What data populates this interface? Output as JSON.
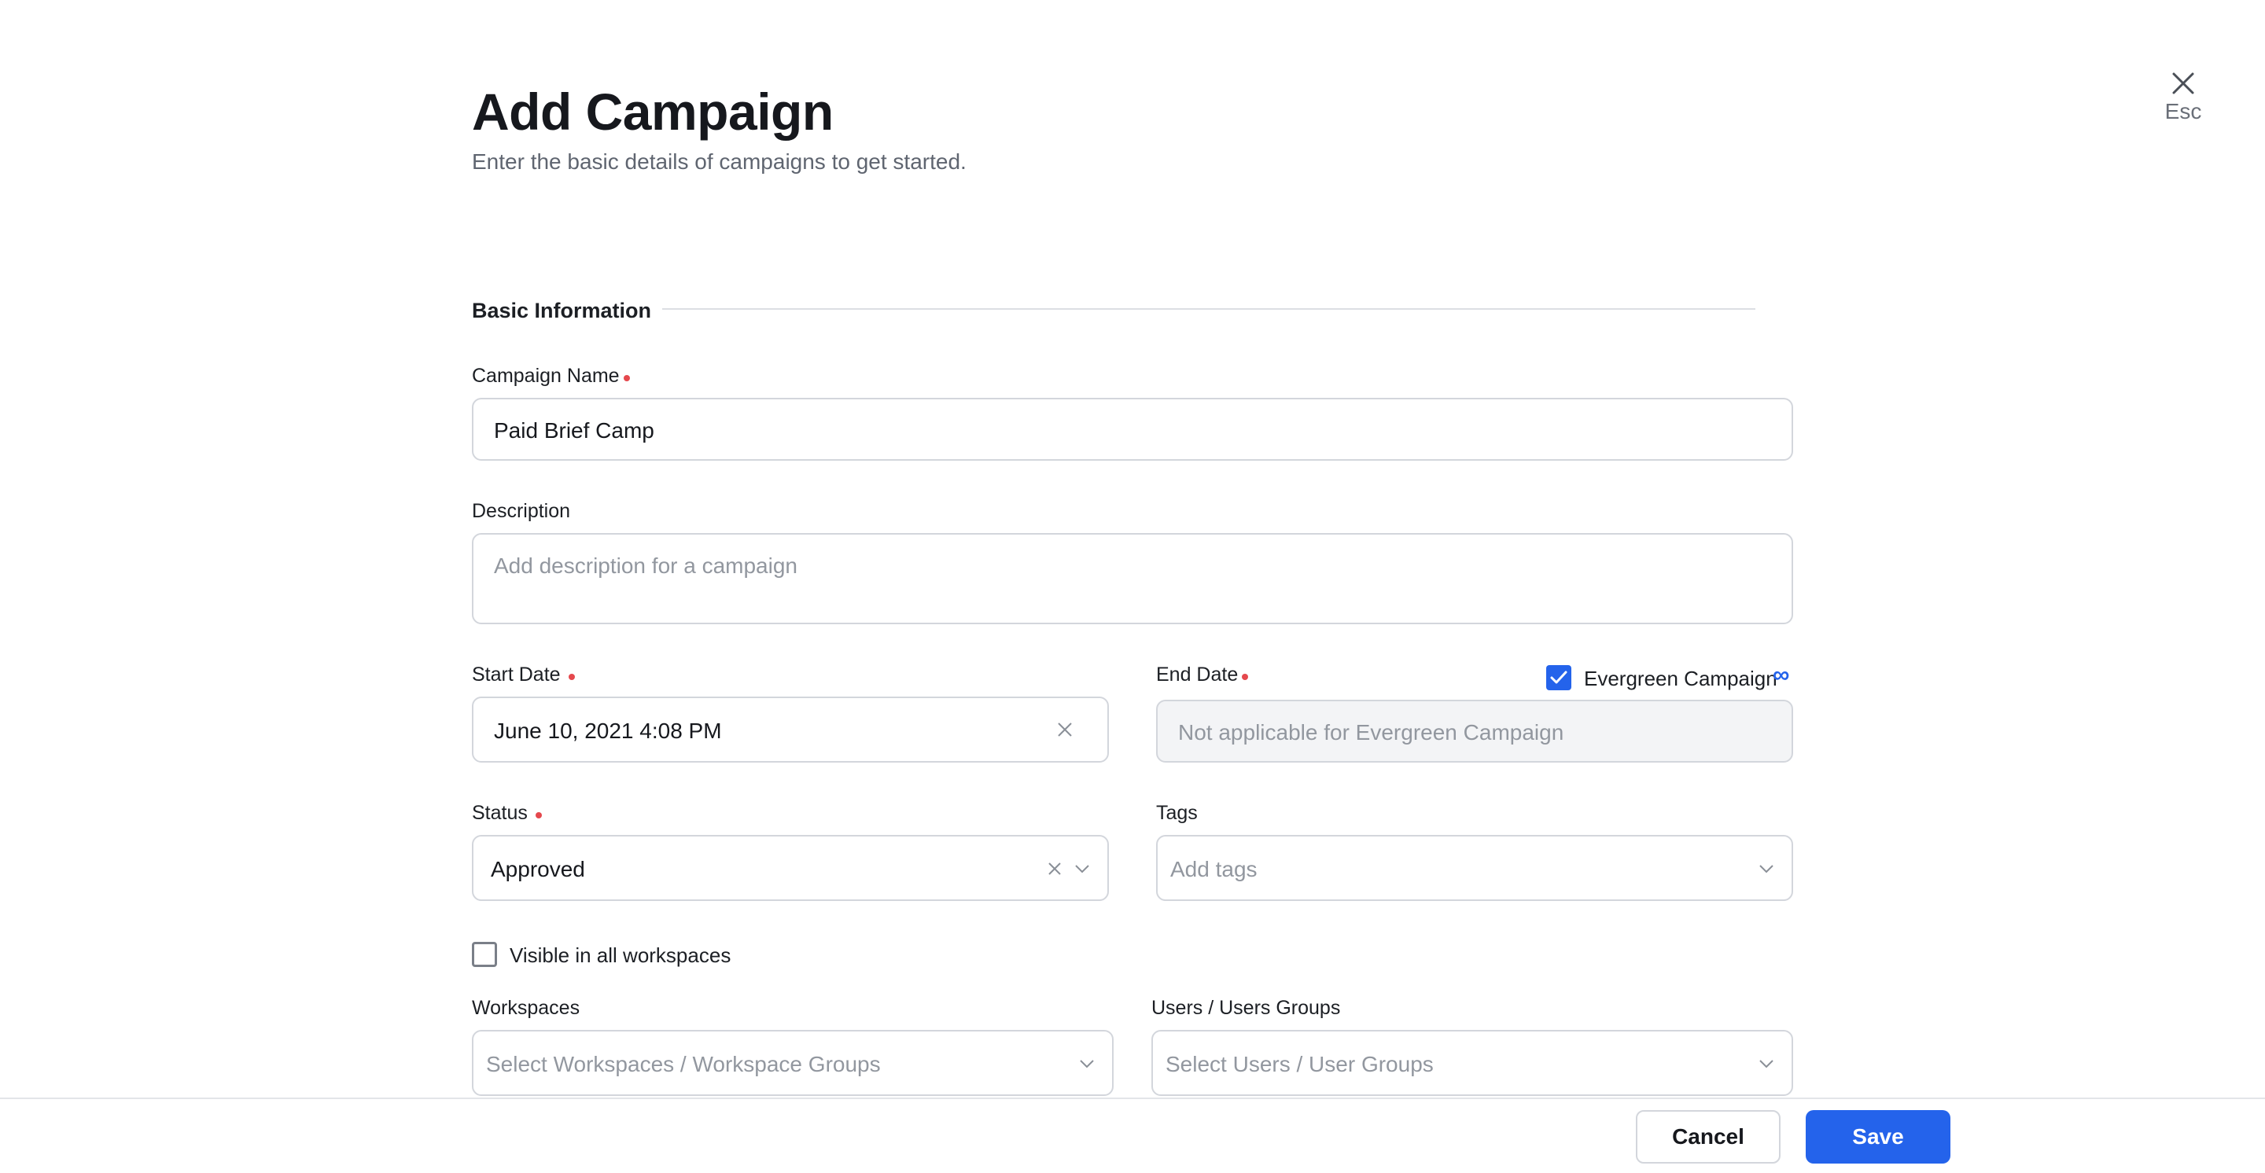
{
  "close": {
    "label": "Esc"
  },
  "header": {
    "title": "Add Campaign",
    "subtitle": "Enter the basic details of campaigns to get started."
  },
  "section": {
    "title": "Basic Information"
  },
  "fields": {
    "campaign_name": {
      "label": "Campaign Name",
      "value": "Paid Brief Camp",
      "required": true
    },
    "description": {
      "label": "Description",
      "placeholder": "Add description for a campaign"
    },
    "start_date": {
      "label": "Start Date",
      "value": "June 10, 2021 4:08 PM",
      "required": true
    },
    "end_date": {
      "label": "End Date",
      "placeholder": "Not applicable for Evergreen Campaign",
      "required": true
    },
    "evergreen": {
      "label": "Evergreen Campaign",
      "checked": true,
      "symbol": "∞"
    },
    "status": {
      "label": "Status",
      "value": "Approved",
      "required": true
    },
    "tags": {
      "label": "Tags",
      "placeholder": "Add tags"
    },
    "visible_all": {
      "label": "Visible in all workspaces",
      "checked": false
    },
    "workspaces": {
      "label": "Workspaces",
      "placeholder": "Select Workspaces / Workspace Groups"
    },
    "users": {
      "label": "Users / Users Groups",
      "placeholder": "Select Users / User Groups"
    }
  },
  "footer": {
    "cancel_label": "Cancel",
    "save_label": "Save"
  },
  "colors": {
    "accent": "#2463eb",
    "required": "#e5484d",
    "border": "#d3d6dc"
  }
}
